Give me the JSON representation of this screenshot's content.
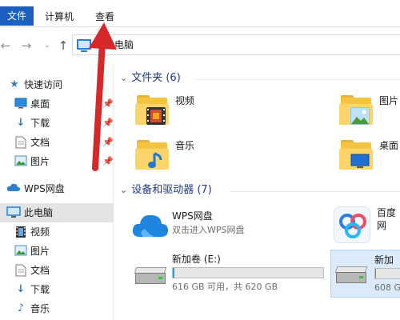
{
  "ribbon": {
    "tabs": [
      {
        "label": "文件"
      },
      {
        "label": "计算机"
      },
      {
        "label": "查看"
      }
    ]
  },
  "navbar": {
    "back_icon": "back-arrow-icon",
    "forward_icon": "forward-arrow-icon",
    "up_icon": "up-arrow-icon",
    "address_text": "此电脑"
  },
  "sidebar": {
    "items": [
      {
        "label": "快速访问",
        "icon": "star-icon",
        "pinned": false
      },
      {
        "label": "桌面",
        "icon": "desktop-icon",
        "pinned": true
      },
      {
        "label": "下载",
        "icon": "download-icon",
        "pinned": true
      },
      {
        "label": "文档",
        "icon": "document-icon",
        "pinned": true
      },
      {
        "label": "图片",
        "icon": "pictures-icon",
        "pinned": true
      },
      {
        "label": "WPS网盘",
        "icon": "cloud-icon",
        "pinned": false
      },
      {
        "label": "此电脑",
        "icon": "computer-icon",
        "pinned": false
      },
      {
        "label": "视频",
        "icon": "video-icon",
        "pinned": false
      },
      {
        "label": "图片",
        "icon": "pictures-icon",
        "pinned": false
      },
      {
        "label": "文档",
        "icon": "document-icon",
        "pinned": false
      },
      {
        "label": "下载",
        "icon": "download-icon",
        "pinned": false
      },
      {
        "label": "音乐",
        "icon": "music-icon",
        "pinned": false
      }
    ]
  },
  "main": {
    "folders_header": "文件夹 (6)",
    "folders": [
      {
        "label": "视频",
        "icon": "video-folder-icon"
      },
      {
        "label": "图片",
        "icon": "pictures-folder-icon"
      },
      {
        "label": "音乐",
        "icon": "music-folder-icon"
      },
      {
        "label": "桌面",
        "icon": "desktop-folder-icon"
      }
    ],
    "devices_header": "设备和驱动器 (7)",
    "devices": [
      {
        "title": "WPS网盘",
        "subtitle": "双击进入WPS网盘",
        "icon": "wps-cloud-icon"
      },
      {
        "title": "百度网",
        "subtitle": "",
        "icon": "baidu-netdisk-icon"
      },
      {
        "title": "新加卷 (E:)",
        "info": "616 GB 可用，共 620 GB",
        "usage": 0.006,
        "icon": "hard-drive-icon"
      },
      {
        "title": "新加卷",
        "info": "608 G",
        "usage": 0.02,
        "icon": "hard-drive-icon"
      }
    ]
  },
  "colors": {
    "accent": "#1b5fc1",
    "arrow": "#d62828",
    "selection": "#e4e4e4",
    "drive_fill": "#26a0da"
  }
}
